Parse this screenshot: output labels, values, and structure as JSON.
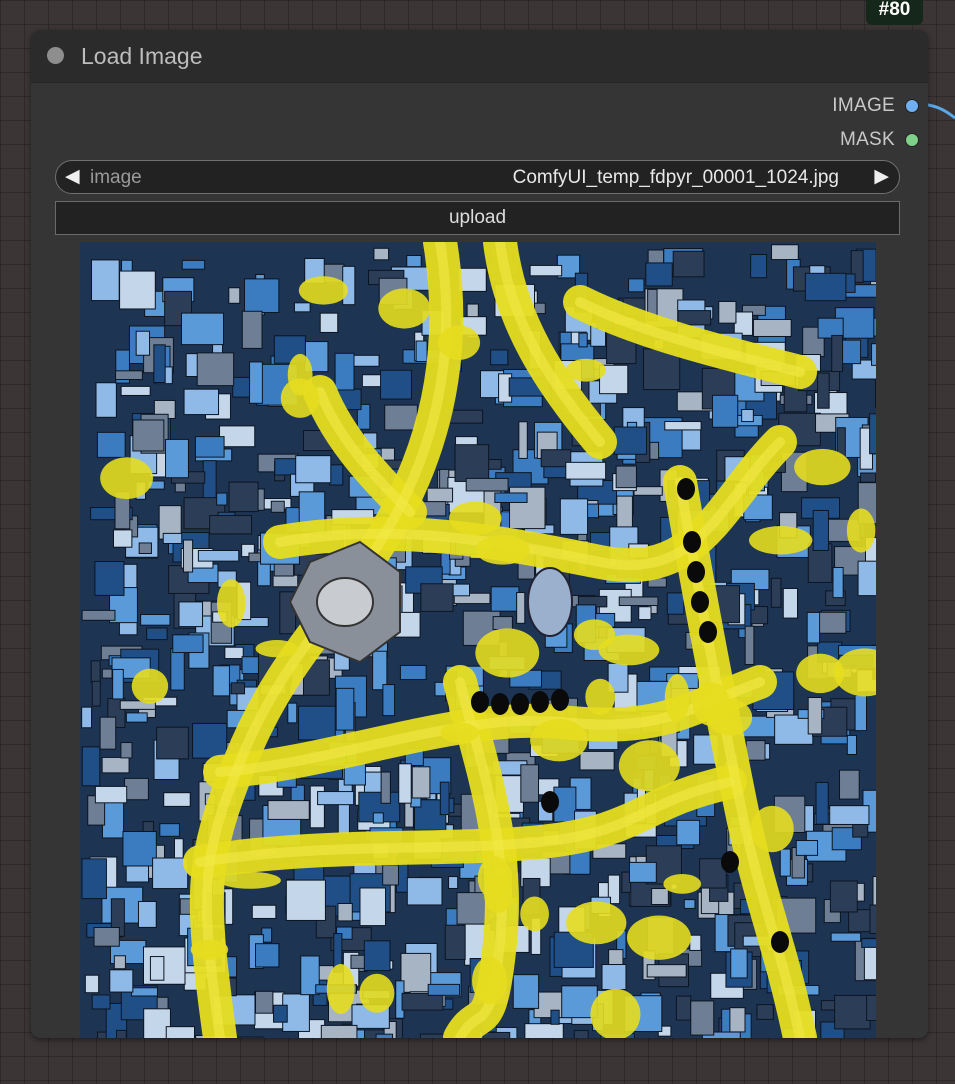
{
  "node": {
    "id_badge": "#80",
    "title": "Load Image",
    "outputs": [
      {
        "label": "IMAGE",
        "color": "#6fb0f0"
      },
      {
        "label": "MASK",
        "color": "#7fd08a"
      }
    ],
    "widgets": {
      "image_combo": {
        "label": "image",
        "value": "ComfyUI_temp_fdpyr_00001_1024.jpg"
      },
      "upload_label": "upload"
    },
    "link_color": "#5aa9e6"
  },
  "icons": {
    "combo_prev": "◀",
    "combo_next": "▶"
  },
  "colors": {
    "canvas_bg": "#3b3536",
    "node_bg": "#353535",
    "header_bg": "#2b2b2b",
    "preview_yellow": "#e6dd1f",
    "preview_blue": "#3c78b8"
  }
}
